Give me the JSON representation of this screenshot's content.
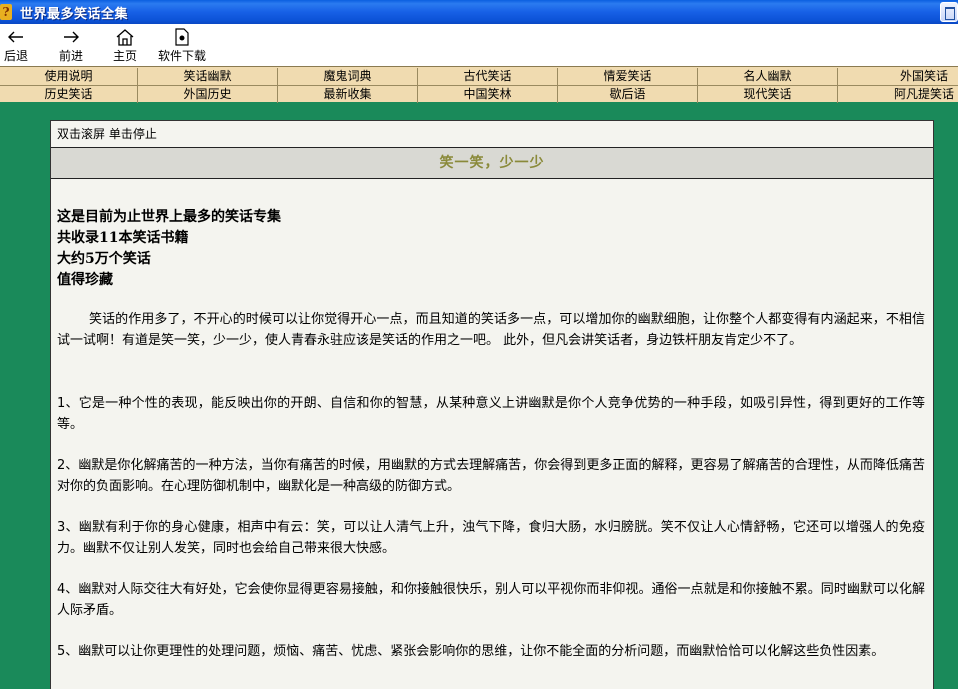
{
  "window": {
    "title": "世界最多笑话全集",
    "app_icon": "help-icon"
  },
  "toolbar": {
    "back": {
      "label": "后退",
      "icon": "arrow-left-icon"
    },
    "forward": {
      "label": "前进",
      "icon": "arrow-right-icon"
    },
    "home": {
      "label": "主页",
      "icon": "home-icon"
    },
    "download": {
      "label": "软件下载",
      "icon": "document-icon"
    }
  },
  "nav": {
    "row1": [
      "使用说明",
      "笑话幽默",
      "魔鬼词典",
      "古代笑话",
      "情爱笑话",
      "名人幽默",
      "外国笑话"
    ],
    "row2": [
      "历史笑话",
      "外国历史",
      "最新收集",
      "中国笑林",
      "歇后语",
      "现代笑话",
      "阿凡提笑话"
    ]
  },
  "content": {
    "hint": "双击滚屏  单击停止",
    "banner": "笑一笑，少一少",
    "intro": [
      "这是目前为止世界上最多的笑话专集",
      "共收录11本笑话书籍",
      "大约5万个笑话",
      "值得珍藏"
    ],
    "paragraphs": [
      "笑话的作用多了，不开心的时候可以让你觉得开心一点，而且知道的笑话多一点，可以增加你的幽默细胞，让你整个人都变得有内涵起来，不相信试一试啊！有道是笑一笑，少一少，使人青春永驻应该是笑话的作用之一吧。  此外，但凡会讲笑话者，身边铁杆朋友肯定少不了。",
      "1、它是一种个性的表现，能反映出你的开朗、自信和你的智慧，从某种意义上讲幽默是你个人竞争优势的一种手段，如吸引异性，得到更好的工作等等。",
      "2、幽默是你化解痛苦的一种方法，当你有痛苦的时候，用幽默的方式去理解痛苦，你会得到更多正面的解释，更容易了解痛苦的合理性，从而降低痛苦对你的负面影响。在心理防御机制中，幽默化是一种高级的防御方式。",
      "3、幽默有利于你的身心健康，相声中有云：笑，可以让人清气上升，浊气下降，食归大肠，水归膀胱。笑不仅让人心情舒畅，它还可以增强人的免疫力。幽默不仅让别人发笑，同时也会给自己带来很大快感。",
      "4、幽默对人际交往大有好处，它会使你显得更容易接触，和你接触很快乐，别人可以平视你而非仰视。通俗一点就是和你接触不累。同时幽默可以化解人际矛盾。",
      "5、幽默可以让你更理性的处理问题，烦恼、痛苦、忧虑、紧张会影响你的思维，让你不能全面的分析问题，而幽默恰恰可以化解这些负性因素。"
    ]
  },
  "colors": {
    "background": "#1a8a5a",
    "nav": "#f0dbb0",
    "banner_text": "#8a8a3a",
    "titlebar": "#0c52d6"
  }
}
